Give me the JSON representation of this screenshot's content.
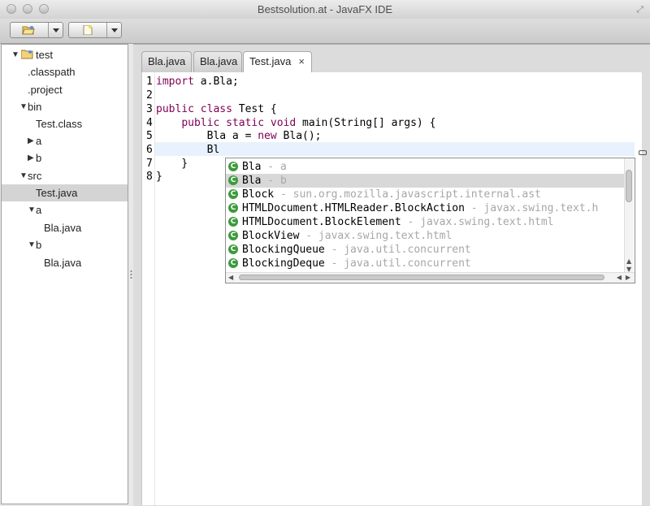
{
  "window": {
    "title": "Bestsolution.at - JavaFX IDE"
  },
  "toolbar": {
    "open_icon": "open-folder-icon",
    "new_icon": "new-file-icon"
  },
  "tree": [
    {
      "label": "test",
      "twisty": "▼",
      "icon": "folder"
    },
    {
      "label": ".classpath"
    },
    {
      "label": ".project"
    },
    {
      "label": "bin",
      "twisty": "▼"
    },
    {
      "label": "Test.class"
    },
    {
      "label": "a",
      "twisty": "▶"
    },
    {
      "label": "b",
      "twisty": "▶"
    },
    {
      "label": "src",
      "twisty": "▼"
    },
    {
      "label": "Test.java",
      "selected": true
    },
    {
      "label": "a",
      "twisty": "▼"
    },
    {
      "label": "Bla.java"
    },
    {
      "label": "b",
      "twisty": "▼"
    },
    {
      "label": "Bla.java"
    }
  ],
  "tabs": [
    {
      "label": "Bla.java"
    },
    {
      "label": "Bla.java"
    },
    {
      "label": "Test.java",
      "active": true,
      "close": "×"
    }
  ],
  "code": {
    "line_numbers": [
      "1",
      "2",
      "3",
      "4",
      "5",
      "6",
      "7",
      "8"
    ],
    "lines": [
      {
        "kw": "import",
        "rest": " a.Bla;"
      },
      {
        "kw": "",
        "rest": ""
      },
      {
        "kw": "public class",
        "rest": " Test {"
      },
      {
        "pre": "    ",
        "kw": "public static void",
        "rest": " main(String[] args) {"
      },
      {
        "pre": "        Bla a = ",
        "kw": "new",
        "rest": " Bla();"
      },
      {
        "pre": "        Bl",
        "kw": "",
        "rest": ""
      },
      {
        "pre": "    }",
        "kw": "",
        "rest": ""
      },
      {
        "pre": "}",
        "kw": "",
        "rest": ""
      }
    ]
  },
  "autocomplete": {
    "icon": "C",
    "items": [
      {
        "name": "Bla",
        "pkg": " - a"
      },
      {
        "name": "Bla",
        "pkg": " - b",
        "selected": true
      },
      {
        "name": "Block",
        "pkg": " - sun.org.mozilla.javascript.internal.ast"
      },
      {
        "name": "HTMLDocument.HTMLReader.BlockAction",
        "pkg": " - javax.swing.text.h"
      },
      {
        "name": "HTMLDocument.BlockElement",
        "pkg": " - javax.swing.text.html"
      },
      {
        "name": "BlockView",
        "pkg": " - javax.swing.text.html"
      },
      {
        "name": "BlockingQueue",
        "pkg": " - java.util.concurrent"
      },
      {
        "name": "BlockingDeque",
        "pkg": " - java.util.concurrent"
      }
    ]
  },
  "colors": {
    "keyword": "#7f0055",
    "class_icon": "#3c9a3c",
    "package_text": "#a7a7a7"
  }
}
